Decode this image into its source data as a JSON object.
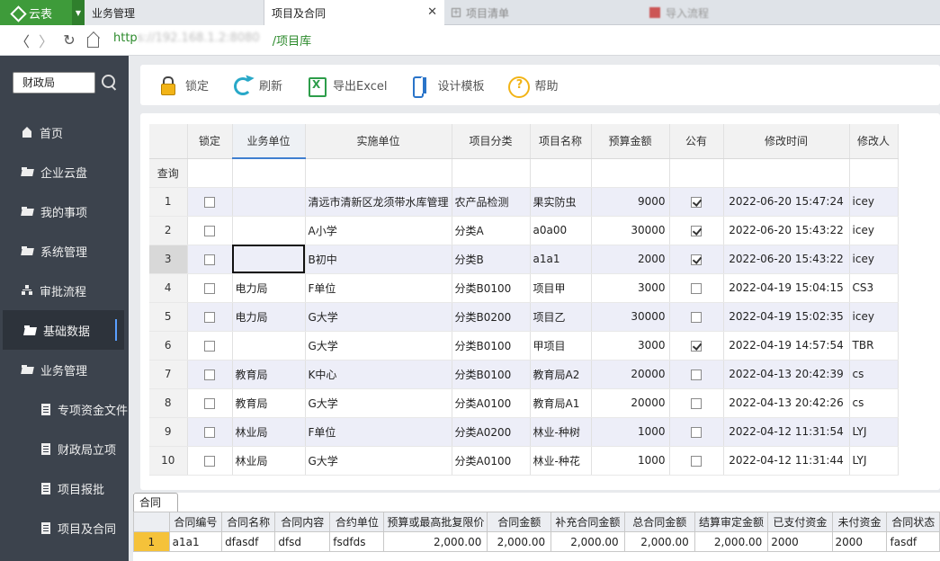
{
  "browser": {
    "brand": "云表",
    "tabs": [
      {
        "label": "业务管理"
      },
      {
        "label": "项目及合同"
      },
      {
        "label": "项目清单"
      },
      {
        "label": "导入流程"
      }
    ],
    "url_prefix": "http",
    "url_host": "s://192.168.1.2:8080",
    "url_path": "/项目库"
  },
  "sidebar": {
    "search_text": "财政局",
    "items": [
      {
        "label": "首页"
      },
      {
        "label": "企业云盘"
      },
      {
        "label": "我的事项"
      },
      {
        "label": "系统管理"
      },
      {
        "label": "审批流程"
      },
      {
        "label": "基础数据"
      },
      {
        "label": "业务管理"
      },
      {
        "label": "专项资金文件"
      },
      {
        "label": "财政局立项"
      },
      {
        "label": "项目报批"
      },
      {
        "label": "项目及合同"
      }
    ]
  },
  "toolbar": {
    "lock": "锁定",
    "refresh": "刷新",
    "export": "导出Excel",
    "design": "设计模板",
    "help": "帮助"
  },
  "grid": {
    "headers": [
      "锁定",
      "业务单位",
      "实施单位",
      "项目分类",
      "项目名称",
      "预算金额",
      "公有",
      "修改时间",
      "修改人"
    ],
    "query_label": "查询",
    "rows": [
      {
        "n": "1",
        "locked": false,
        "unit": "",
        "impl": "清远市清新区龙须带水库管理",
        "cat": "农产品检测",
        "name": "果实防虫",
        "budget": "9000",
        "pub": true,
        "time": "2022-06-20 15:47:24",
        "user": "icey"
      },
      {
        "n": "2",
        "locked": false,
        "unit": "",
        "impl": "A小学",
        "cat": "分类A",
        "name": "a0a00",
        "budget": "30000",
        "pub": true,
        "time": "2022-06-20 15:43:22",
        "user": "icey"
      },
      {
        "n": "3",
        "locked": false,
        "unit": "",
        "impl": "B初中",
        "cat": "分类B",
        "name": "a1a1",
        "budget": "2000",
        "pub": true,
        "time": "2022-06-20 15:43:22",
        "user": "icey"
      },
      {
        "n": "4",
        "locked": false,
        "unit": "电力局",
        "impl": "F单位",
        "cat": "分类B0100",
        "name": "项目甲",
        "budget": "3000",
        "pub": false,
        "time": "2022-04-19 15:04:15",
        "user": "CS3"
      },
      {
        "n": "5",
        "locked": false,
        "unit": "电力局",
        "impl": "G大学",
        "cat": "分类B0200",
        "name": "项目乙",
        "budget": "30000",
        "pub": false,
        "time": "2022-04-19 15:02:35",
        "user": "icey"
      },
      {
        "n": "6",
        "locked": false,
        "unit": "",
        "impl": "G大学",
        "cat": "分类B0100",
        "name": "甲项目",
        "budget": "3000",
        "pub": true,
        "time": "2022-04-19 14:57:54",
        "user": "TBR"
      },
      {
        "n": "7",
        "locked": false,
        "unit": "教育局",
        "impl": "K中心",
        "cat": "分类B0100",
        "name": "教育局A2",
        "budget": "20000",
        "pub": false,
        "time": "2022-04-13 20:42:39",
        "user": "cs"
      },
      {
        "n": "8",
        "locked": false,
        "unit": "教育局",
        "impl": "G大学",
        "cat": "分类A0100",
        "name": "教育局A1",
        "budget": "20000",
        "pub": false,
        "time": "2022-04-13 20:42:26",
        "user": "cs"
      },
      {
        "n": "9",
        "locked": false,
        "unit": "林业局",
        "impl": "F单位",
        "cat": "分类A0200",
        "name": "林业-种树",
        "budget": "1000",
        "pub": false,
        "time": "2022-04-12 11:31:54",
        "user": "LYJ"
      },
      {
        "n": "10",
        "locked": false,
        "unit": "林业局",
        "impl": "G大学",
        "cat": "分类A0100",
        "name": "林业-种花",
        "budget": "1000",
        "pub": false,
        "time": "2022-04-12 11:31:44",
        "user": "LYJ"
      }
    ]
  },
  "contract": {
    "tab_label": "合同",
    "headers": [
      "合同编号",
      "合同名称",
      "合同内容",
      "合约单位",
      "预算或最高批复限价",
      "合同金额",
      "补充合同金额",
      "总合同金额",
      "结算审定金额",
      "已支付资金",
      "未付资金",
      "合同状态"
    ],
    "rows": [
      {
        "n": "1",
        "cells": [
          "a1a1",
          "dfasdf",
          "dfsd",
          "fsdfds",
          "2,000.00",
          "2,000.00",
          "2,000.00",
          "2,000.00",
          "2,000.00",
          "2000",
          "2000",
          "fasdf"
        ]
      }
    ]
  }
}
